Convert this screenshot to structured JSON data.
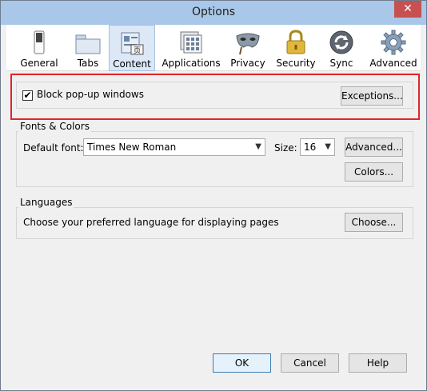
{
  "window": {
    "title": "Options",
    "close_glyph": "✕"
  },
  "toolbar": {
    "items": [
      {
        "label": "General",
        "icon": "switch-icon"
      },
      {
        "label": "Tabs",
        "icon": "folder-tabs-icon"
      },
      {
        "label": "Content",
        "icon": "content-page-icon",
        "selected": true
      },
      {
        "label": "Applications",
        "icon": "applications-icon"
      },
      {
        "label": "Privacy",
        "icon": "mask-icon"
      },
      {
        "label": "Security",
        "icon": "padlock-icon"
      },
      {
        "label": "Sync",
        "icon": "sync-icon"
      },
      {
        "label": "Advanced",
        "icon": "gear-icon"
      }
    ]
  },
  "popups": {
    "checkbox_label": "Block pop-up windows",
    "checked": true,
    "check_glyph": "✔",
    "exceptions_button": "Exceptions..."
  },
  "fonts": {
    "group_title": "Fonts & Colors",
    "default_font_label": "Default font:",
    "default_font_value": "Times New Roman",
    "size_label": "Size:",
    "size_value": "16",
    "advanced_button": "Advanced...",
    "colors_button": "Colors..."
  },
  "languages": {
    "group_title": "Languages",
    "description": "Choose your preferred language for displaying pages",
    "choose_button": "Choose..."
  },
  "footer": {
    "ok_button": "OK",
    "cancel_button": "Cancel",
    "help_button": "Help"
  },
  "colors": {
    "titlebar": "#a9c7e8",
    "close_button": "#c75050",
    "highlight_frame": "#e0242b",
    "selected_tab": "#dce8f6"
  }
}
